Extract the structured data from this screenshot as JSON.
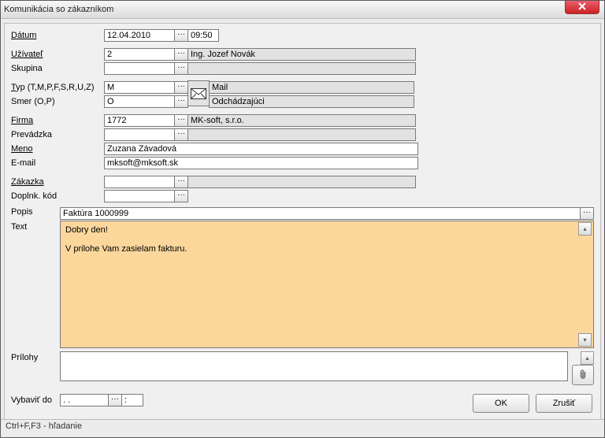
{
  "title": "Komunikácia so zákazníkom",
  "statusbar": "Ctrl+F,F3 - hľadanie",
  "labels": {
    "datum": "Dátum",
    "uzivatel": "Užívateľ",
    "skupina": "Skupina",
    "typ": "Typ (T,M,P,F,S,R,U,Z)",
    "smer": "Smer (O,P)",
    "firma": "Firma",
    "prevadzka": "Prevádzka",
    "meno": "Meno",
    "email": "E-mail",
    "zakazka": "Zákazka",
    "doplnk": "Doplnk. kód",
    "popis": "Popis",
    "text": "Text",
    "prilohy": "Prílohy",
    "vybavit": "Vybaviť do"
  },
  "values": {
    "datum": "12.04.2010",
    "cas": "09:50",
    "uzivatel_id": "2",
    "uzivatel_name": "Ing. Jozef Novák",
    "skupina": "",
    "typ_code": "M",
    "typ_label": "Mail",
    "smer_code": "O",
    "smer_label": "Odchádzajúci",
    "firma_id": "1772",
    "firma_name": "MK-soft, s.r.o.",
    "prevadzka": "",
    "meno": "Zuzana Závadová",
    "email": "mksoft@mksoft.sk",
    "zakazka": "",
    "doplnk": "",
    "popis": "Faktúra 1000999",
    "text_line1": "Dobry den!",
    "text_line2": "V prilohe Vam zasielam fakturu.",
    "vybavit_date": " .  .",
    "vybavit_time": " :"
  },
  "buttons": {
    "ok": "OK",
    "cancel": "Zrušiť"
  }
}
